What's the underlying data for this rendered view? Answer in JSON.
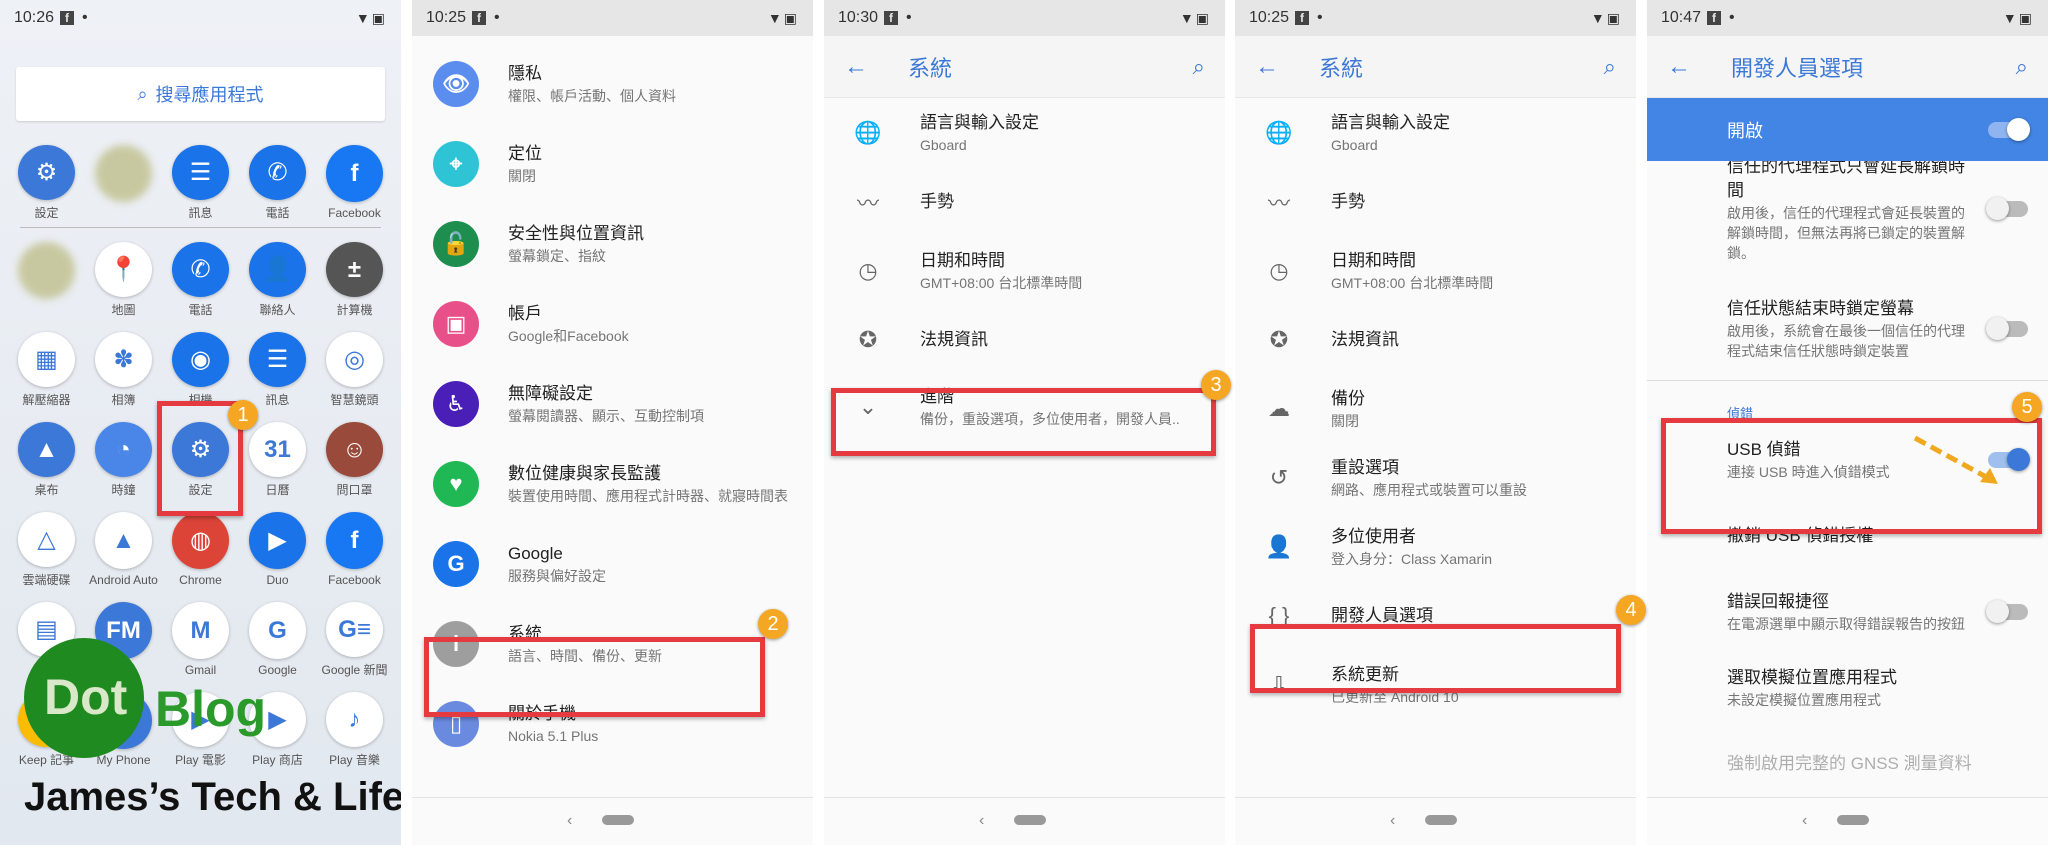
{
  "panels": [
    {
      "status": {
        "time": "10:26"
      },
      "search_placeholder": "搜尋應用程式",
      "apps": [
        {
          "label": "設定",
          "icon": "gear-icon",
          "glyph": "⚙",
          "color": "#3b78d8"
        },
        {
          "label": "",
          "icon": "blurred-app-icon",
          "glyph": "",
          "color": "#c8c8a0"
        },
        {
          "label": "訊息",
          "icon": "messages-icon",
          "glyph": "☰",
          "color": "#1a73e8"
        },
        {
          "label": "電話",
          "icon": "phone-icon",
          "glyph": "✆",
          "color": "#1a73e8"
        },
        {
          "label": "Facebook",
          "icon": "facebook-icon",
          "glyph": "f",
          "color": "#1877f2"
        },
        {
          "label": "",
          "icon": "blurred-app-icon",
          "glyph": "",
          "color": "#c8c8a0"
        },
        {
          "label": "地圖",
          "icon": "maps-icon",
          "glyph": "📍",
          "color": "#ffffff"
        },
        {
          "label": "電話",
          "icon": "phone-icon",
          "glyph": "✆",
          "color": "#1a73e8"
        },
        {
          "label": "聯絡人",
          "icon": "contacts-icon",
          "glyph": "👤",
          "color": "#1a73e8"
        },
        {
          "label": "計算機",
          "icon": "calculator-icon",
          "glyph": "±",
          "color": "#555555"
        },
        {
          "label": "解壓縮器",
          "icon": "unzip-icon",
          "glyph": "▦",
          "color": "#ffffff"
        },
        {
          "label": "相簿",
          "icon": "photos-icon",
          "glyph": "✽",
          "color": "#ffffff"
        },
        {
          "label": "相機",
          "icon": "camera-icon",
          "glyph": "◉",
          "color": "#1a73e8"
        },
        {
          "label": "訊息",
          "icon": "messages-icon",
          "glyph": "☰",
          "color": "#1a73e8"
        },
        {
          "label": "智慧鏡頭",
          "icon": "lens-icon",
          "glyph": "◎",
          "color": "#ffffff"
        },
        {
          "label": "桌布",
          "icon": "wallpaper-icon",
          "glyph": "▲",
          "color": "#3b78d8"
        },
        {
          "label": "時鐘",
          "icon": "clock-icon",
          "glyph": "◔",
          "color": "#4a86e8"
        },
        {
          "label": "設定",
          "icon": "gear-icon",
          "glyph": "⚙",
          "color": "#3b78d8"
        },
        {
          "label": "日曆",
          "icon": "calendar-icon",
          "glyph": "31",
          "color": "#ffffff"
        },
        {
          "label": "問口罩",
          "icon": "mask-app-icon",
          "glyph": "☺",
          "color": "#9a4a3a"
        },
        {
          "label": "雲端硬碟",
          "icon": "drive-icon",
          "glyph": "△",
          "color": "#ffffff"
        },
        {
          "label": "Android Auto",
          "icon": "android-auto-icon",
          "glyph": "▲",
          "color": "#ffffff"
        },
        {
          "label": "Chrome",
          "icon": "chrome-icon",
          "glyph": "◍",
          "color": "#db4437"
        },
        {
          "label": "Duo",
          "icon": "duo-icon",
          "glyph": "▶",
          "color": "#1a73e8"
        },
        {
          "label": "Facebook",
          "icon": "facebook-icon",
          "glyph": "f",
          "color": "#1877f2"
        },
        {
          "label": "檔案",
          "icon": "files-icon",
          "glyph": "▤",
          "color": "#ffffff"
        },
        {
          "label": "FM",
          "icon": "fm-radio-icon",
          "glyph": "FM",
          "color": "#3b78d8"
        },
        {
          "label": "Gmail",
          "icon": "gmail-icon",
          "glyph": "M",
          "color": "#ffffff"
        },
        {
          "label": "Google",
          "icon": "google-icon",
          "glyph": "G",
          "color": "#ffffff"
        },
        {
          "label": "Google 新聞",
          "icon": "google-news-icon",
          "glyph": "G≡",
          "color": "#ffffff"
        },
        {
          "label": "Keep 記事",
          "icon": "keep-icon",
          "glyph": "✎",
          "color": "#fbbc04"
        },
        {
          "label": "My Phone",
          "icon": "my-phone-icon",
          "glyph": "☏",
          "color": "#3b78d8"
        },
        {
          "label": "Play 電影",
          "icon": "play-movies-icon",
          "glyph": "▶",
          "color": "#ffffff"
        },
        {
          "label": "Play 商店",
          "icon": "play-store-icon",
          "glyph": "▶",
          "color": "#ffffff"
        },
        {
          "label": "Play 音樂",
          "icon": "play-music-icon",
          "glyph": "♪",
          "color": "#ffffff"
        }
      ]
    },
    {
      "status": {
        "time": "10:25"
      },
      "rows": [
        {
          "title": "隱私",
          "subtitle": "權限、帳戶活動、個人資料",
          "icon": "privacy-icon",
          "glyph": "👁",
          "color": "#5b8def"
        },
        {
          "title": "定位",
          "subtitle": "關閉",
          "icon": "location-icon",
          "glyph": "⌖",
          "color": "#2ec4d6"
        },
        {
          "title": "安全性與位置資訊",
          "subtitle": "螢幕鎖定、指紋",
          "icon": "lock-icon",
          "glyph": "🔓",
          "color": "#1e8e4e"
        },
        {
          "title": "帳戶",
          "subtitle": "Google和Facebook",
          "icon": "account-icon",
          "glyph": "▣",
          "color": "#e8508a"
        },
        {
          "title": "無障礙設定",
          "subtitle": "螢幕閱讀器、顯示、互動控制項",
          "icon": "accessibility-icon",
          "glyph": "♿",
          "color": "#4a1fb8"
        },
        {
          "title": "數位健康與家長監護",
          "subtitle": "裝置使用時間、應用程式計時器、就寢時間表",
          "icon": "wellbeing-icon",
          "glyph": "♥",
          "color": "#1fb855"
        },
        {
          "title": "Google",
          "subtitle": "服務與偏好設定",
          "icon": "google-icon",
          "glyph": "G",
          "color": "#1a73e8"
        },
        {
          "title": "系統",
          "subtitle": "語言、時間、備份、更新",
          "icon": "info-icon",
          "glyph": "i",
          "color": "#9e9e9e"
        },
        {
          "title": "關於手機",
          "subtitle": "Nokia 5.1 Plus",
          "icon": "phone-info-icon",
          "glyph": "▯",
          "color": "#6a8ae0"
        }
      ]
    },
    {
      "status": {
        "time": "10:30"
      },
      "title": "系統",
      "rows": [
        {
          "title": "語言與輸入設定",
          "subtitle": "Gboard",
          "icon": "globe-icon",
          "glyph": "🌐"
        },
        {
          "title": "手勢",
          "subtitle": "",
          "icon": "gesture-icon",
          "glyph": "〰"
        },
        {
          "title": "日期和時間",
          "subtitle": "GMT+08:00 台北標準時間",
          "icon": "clock-icon",
          "glyph": "◷"
        },
        {
          "title": "法規資訊",
          "subtitle": "",
          "icon": "badge-icon",
          "glyph": "✪"
        },
        {
          "title": "進階",
          "subtitle": "備份，重設選項，多位使用者，開發人員..",
          "icon": "chevron-down-icon",
          "glyph": "⌄"
        }
      ]
    },
    {
      "status": {
        "time": "10:25"
      },
      "title": "系統",
      "rows": [
        {
          "title": "語言與輸入設定",
          "subtitle": "Gboard",
          "icon": "globe-icon",
          "glyph": "🌐"
        },
        {
          "title": "手勢",
          "subtitle": "",
          "icon": "gesture-icon",
          "glyph": "〰"
        },
        {
          "title": "日期和時間",
          "subtitle": "GMT+08:00 台北標準時間",
          "icon": "clock-icon",
          "glyph": "◷"
        },
        {
          "title": "法規資訊",
          "subtitle": "",
          "icon": "badge-icon",
          "glyph": "✪"
        },
        {
          "title": "備份",
          "subtitle": "關閉",
          "icon": "cloud-upload-icon",
          "glyph": "☁"
        },
        {
          "title": "重設選項",
          "subtitle": "網路、應用程式或裝置可以重設",
          "icon": "history-icon",
          "glyph": "↺"
        },
        {
          "title": "多位使用者",
          "subtitle": "登入身分：Class Xamarin",
          "icon": "person-icon",
          "glyph": "👤"
        },
        {
          "title": "開發人員選項",
          "subtitle": "",
          "icon": "braces-icon",
          "glyph": "{ }"
        },
        {
          "title": "系統更新",
          "subtitle": "已更新至 Android 10",
          "icon": "system-update-icon",
          "glyph": "⇩"
        }
      ]
    },
    {
      "status": {
        "time": "10:47"
      },
      "title": "開發人員選項",
      "master": {
        "label": "開啟",
        "on": true
      },
      "rows_top": [
        {
          "title": "信任的代理程式只會延長解鎖時間",
          "subtitle": "啟用後，信任的代理程式會延長裝置的解鎖時間，但無法再將已鎖定的裝置解鎖。",
          "on": false
        },
        {
          "title": "信任狀態結束時鎖定螢幕",
          "subtitle": "啟用後，系統會在最後一個信任的代理程式結束信任狀態時鎖定裝置",
          "on": false
        }
      ],
      "category": "偵錯",
      "rows_debug": [
        {
          "title": "USB 偵錯",
          "subtitle": "連接 USB 時進入偵錯模式",
          "toggle": true,
          "on": true
        },
        {
          "title": "撤銷 USB 偵錯授權",
          "subtitle": "",
          "toggle": false
        },
        {
          "title": "錯誤回報捷徑",
          "subtitle": "在電源選單中顯示取得錯誤報告的按鈕",
          "toggle": true,
          "on": false
        },
        {
          "title": "選取模擬位置應用程式",
          "subtitle": "未設定模擬位置應用程式",
          "toggle": false
        },
        {
          "title": "強制啟用完整的 GNSS 測量資料",
          "subtitle": "",
          "toggle": false
        }
      ]
    }
  ],
  "steps": [
    "1",
    "2",
    "3",
    "4",
    "5"
  ],
  "watermark": {
    "logo": "Dot Blog",
    "logo_dot": "Dot",
    "logo_blog": "Blog",
    "text": "James’s Tech & Life Blog"
  },
  "colors": {
    "accent": "#3b78d8",
    "highlight": "#e53b40",
    "badge": "#f5a623",
    "toggle_on": "#3b78d8"
  }
}
